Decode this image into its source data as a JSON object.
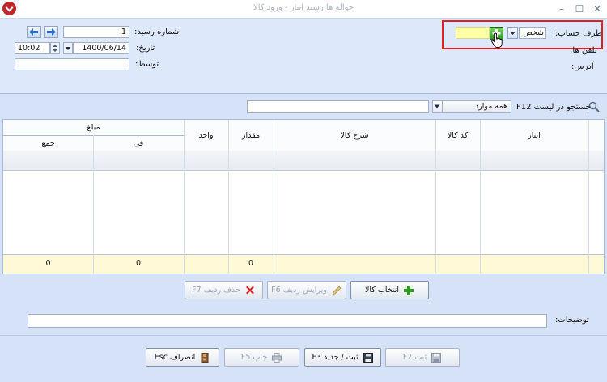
{
  "window": {
    "title": "حواله ها رسید انبار - ورود کالا",
    "minimize": "–",
    "maximize": "☐",
    "close": "✕"
  },
  "header": {
    "receipt_number_label": "شماره رسید:",
    "receipt_number_value": "1",
    "date_label": "تاریخ:",
    "date_value": "1400/06/14",
    "time_value": "10:02",
    "by_label": "توسط:",
    "by_value": "",
    "account_side_label": "طرف حساب:",
    "account_side_value": "شخص",
    "phone_label": "تلفن ها:",
    "address_label": "آدرس:"
  },
  "search": {
    "label": "جستجو در لیست F12",
    "scope_value": "همه موارد",
    "query": ""
  },
  "grid": {
    "columns": {
      "warehouse": "انبار",
      "code": "کد کالا",
      "description": "شرح کالا",
      "quantity": "مقدار",
      "unit": "واحد",
      "amount": "مبلغ",
      "unit_price": "فی",
      "total": "جمع"
    },
    "footer": {
      "quantity": "0",
      "unit_price": "0",
      "total": "0"
    }
  },
  "row_buttons": {
    "select_item": "انتخاب کالا",
    "edit_row": "ویرایش ردیف F6",
    "delete_row": "حذف ردیف F7"
  },
  "notes": {
    "label": "توضیحات:",
    "value": ""
  },
  "actions": {
    "save": "ثبت F2",
    "save_new": "ثبت / جدید F3",
    "print": "چاپ F5",
    "cancel": "انصراف Esc"
  },
  "colors": {
    "accent_green": "#2f9b22",
    "highlight": "#e02020",
    "delete_red": "#d62828"
  }
}
